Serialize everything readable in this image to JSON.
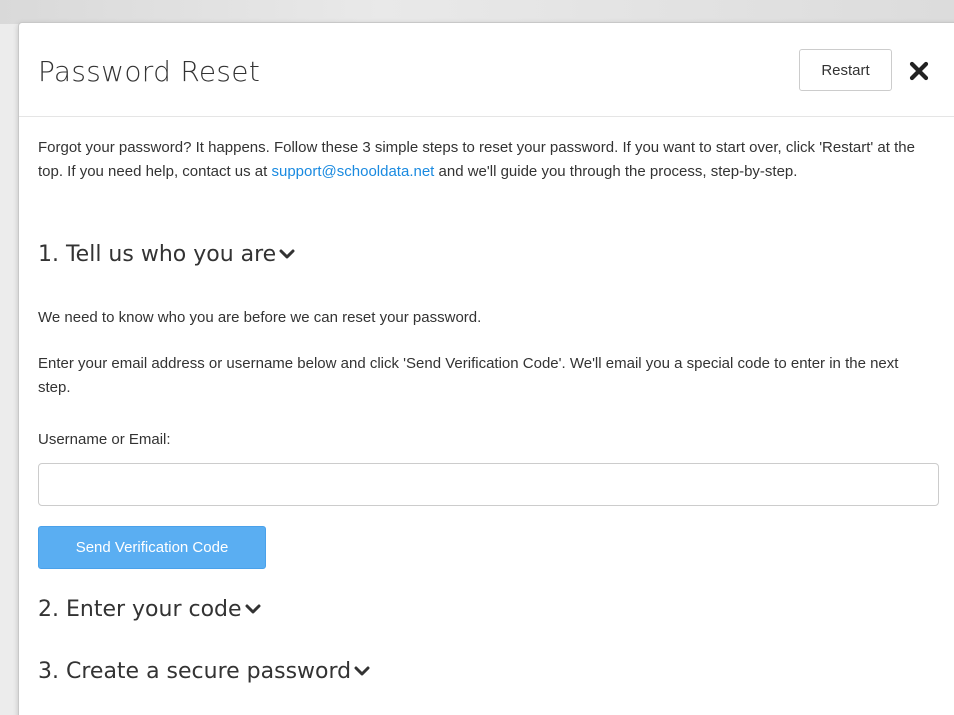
{
  "modal": {
    "title": "Password Reset",
    "restart_label": "Restart",
    "close_icon": "close-icon",
    "intro": {
      "before_link": "Forgot your password? It happens. Follow these 3 simple steps to reset your password. If you want to start over, click 'Restart' at the top. If you need help, contact us at ",
      "link_text": "support@schooldata.net",
      "after_link": " and we'll guide you through the process, step-by-step."
    },
    "steps": [
      {
        "heading": "1. Tell us who you are",
        "expanded": true,
        "paragraph_1": "We need to know who you are before we can reset your password.",
        "paragraph_2": "Enter your email address or username below and click 'Send Verification Code'. We'll email you a special code to enter in the next step.",
        "field_label": "Username or Email:",
        "field_value": "",
        "field_placeholder": "",
        "button_label": "Send Verification Code"
      },
      {
        "heading": "2. Enter your code",
        "expanded": false
      },
      {
        "heading": "3. Create a secure password",
        "expanded": false
      }
    ],
    "chevron_icon": "chevron-down-icon"
  },
  "colors": {
    "link": "#1a8ae0",
    "primary_button": "#5aaef2",
    "text": "#333333"
  }
}
